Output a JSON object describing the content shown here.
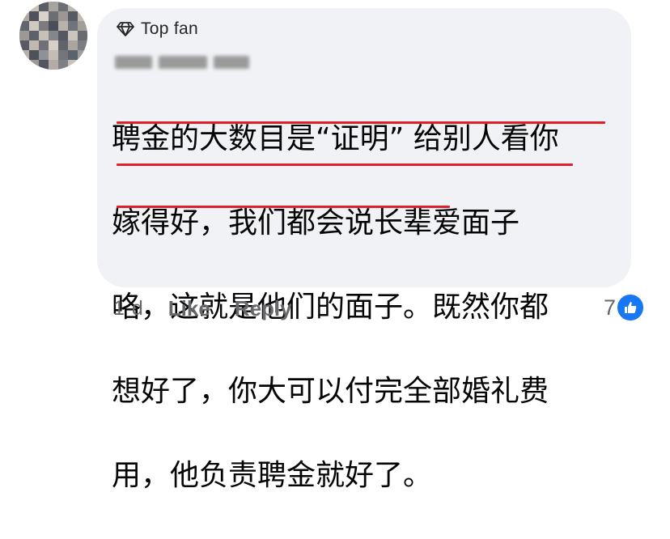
{
  "comment": {
    "badge": {
      "icon": "diamond-icon",
      "label": "Top fan"
    },
    "text_lines": [
      "聘金的大数目是“证明” 给别人看你",
      "嫁得好，我们都会说长辈爱面子",
      "咯，这就是他们的面子。既然你都",
      "想好了，你大可以付完全部婚礼费",
      "用，他负责聘金就好了。"
    ]
  },
  "footer": {
    "time": "1 d",
    "like_label": "Like",
    "reply_label": "Reply",
    "reaction_count": "7",
    "reaction_icon": "thumbs-up-icon"
  },
  "colors": {
    "bubble": "#f0f2f5",
    "underline": "#e0202a",
    "like": "#1877f2",
    "meta": "#65676b"
  }
}
